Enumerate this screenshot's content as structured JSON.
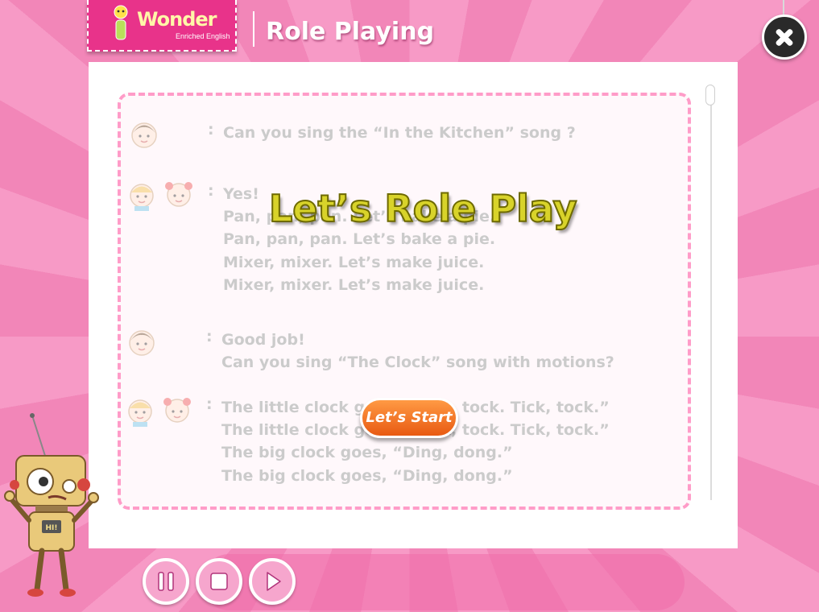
{
  "app": {
    "logo_letter": "i",
    "logo_brand": "Wonder",
    "logo_tagline": "Enriched English",
    "title": "Role Playing"
  },
  "script": {
    "lines": [
      {
        "speaker": "teacher",
        "text": [
          "Can you sing the “In the Kitchen” song ?"
        ]
      },
      {
        "speaker": "kids",
        "text": [
          "Yes!",
          "Pan, pan, pan. Let’s bake a pie.",
          "Pan, pan, pan. Let’s bake a pie.",
          "Mixer, mixer. Let’s make juice.",
          "Mixer, mixer. Let’s make juice."
        ]
      },
      {
        "speaker": "teacher",
        "text": [
          "Good job!",
          "Can you sing “The Clock” song with motions?"
        ]
      },
      {
        "speaker": "kids",
        "text": [
          "The little clock goes, “Tick, tock. Tick, tock.”",
          "The little clock goes, “Tick, tock. Tick, tock.”",
          "The big clock goes, “Ding, dong.”",
          "The big clock goes, “Ding, dong.”"
        ]
      }
    ],
    "separator": ":"
  },
  "overlay": {
    "title": "Let’s Role Play",
    "start_label": "Let’s Start"
  },
  "controls": {
    "items": [
      "pause-icon",
      "stop-icon",
      "play-icon"
    ]
  },
  "robot": {
    "chest_label": "HI!"
  },
  "colors": {
    "background": "#f58fbf",
    "logo": "#e8338a",
    "dashed_border": "#ff9cc8",
    "start_button": "#ef7022",
    "overlay_title": "#d8d32a",
    "faded_text": "#cbcbcb"
  }
}
